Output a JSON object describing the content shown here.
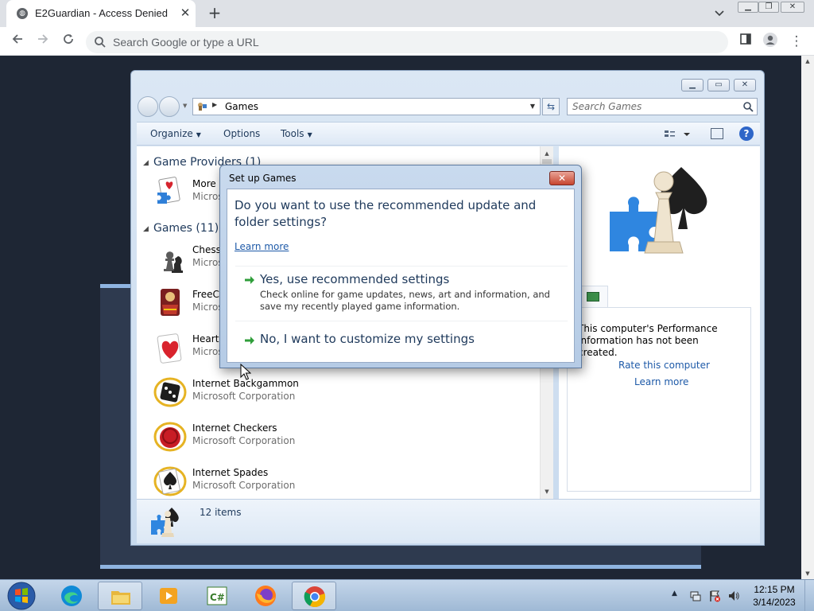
{
  "browser": {
    "tab_title": "E2Guardian - Access Denied",
    "omnibox_placeholder": "Search Google or type a URL"
  },
  "explorer": {
    "location": "Games",
    "search_placeholder": "Search Games",
    "commands": {
      "organize": "Organize",
      "options": "Options",
      "tools": "Tools"
    },
    "groups": {
      "providers": "Game Providers (1)",
      "games": "Games (11)"
    },
    "items": [
      {
        "name": "More G",
        "publisher": "Micros"
      },
      {
        "name": "Chess",
        "publisher": "Micros"
      },
      {
        "name": "FreeCe",
        "publisher": "Micros"
      },
      {
        "name": "Hearts",
        "publisher": "Micros"
      },
      {
        "name": "Internet Backgammon",
        "publisher": "Microsoft Corporation"
      },
      {
        "name": "Internet Checkers",
        "publisher": "Microsoft Corporation"
      },
      {
        "name": "Internet Spades",
        "publisher": "Microsoft Corporation"
      }
    ],
    "performance": {
      "message": "This computer's Performance Information has not been created.",
      "rate_link": "Rate this computer",
      "learn_link": "Learn more"
    },
    "status": "12 items"
  },
  "dialog": {
    "title": "Set up Games",
    "close_label": "✕",
    "question": "Do you want to use the recommended update and folder settings?",
    "learn_more": "Learn more",
    "option_yes": {
      "title": "Yes, use recommended settings",
      "description": "Check online for game updates, news, art and information, and save my recently played game information."
    },
    "option_no": {
      "title": "No, I want to customize my settings"
    }
  },
  "taskbar": {
    "time": "12:15 PM",
    "date": "3/14/2023"
  },
  "colors": {
    "explorer_blue": "#1e395b",
    "link_blue": "#1e5aa8",
    "arrow_green": "#2f9e3a"
  }
}
